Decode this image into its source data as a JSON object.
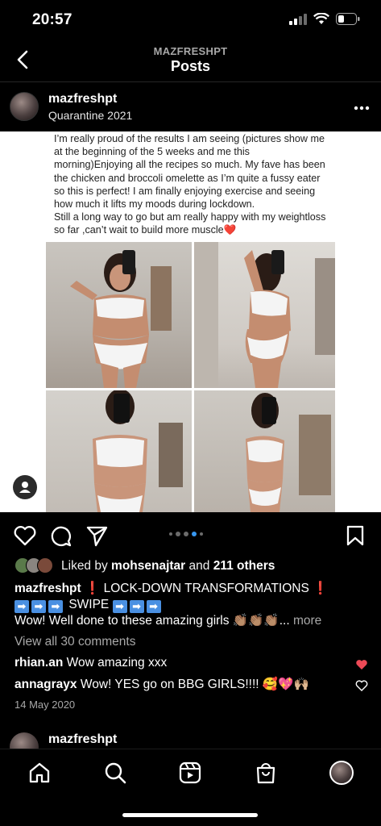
{
  "status_bar": {
    "time": "20:57"
  },
  "header": {
    "account": "MAZFRESHPT",
    "title": "Posts"
  },
  "post": {
    "username": "mazfreshpt",
    "location": "Quarantine 2021",
    "image_text": "I’m really proud of the results I am seeing (pictures show me\nat the beginning of the 5 weeks and me this\nmorning)Enjoying all the recipes so much. My fave has been\nthe chicken and broccoli omelette as I’m quite a fussy eater\nso this is perfect! I am finally enjoying exercise and seeing\nhow much it lifts my moods during lockdown.\nStill a long way to go but am really happy with my weightloss\nso far ,can’t wait to build more muscle❤️",
    "carousel": {
      "count": 5,
      "active_index": 3
    },
    "likes": {
      "prefix": "Liked by",
      "user": "mohsenajtar",
      "and": "and",
      "others": "211 others"
    },
    "caption": {
      "username": "mazfreshpt",
      "headline": "LOCK-DOWN TRANSFORMATIONS",
      "exclaim": "❗",
      "arrow": "➡",
      "swipe": "SWIPE",
      "line3": "Wow! Well done to these amazing girls 👏🏽👏🏽👏🏽...",
      "more": "more"
    },
    "view_comments": "View all 30 comments",
    "comments": [
      {
        "user": "rhian.an",
        "text": "Wow amazing xxx",
        "liked": true
      },
      {
        "user": "annagrayx",
        "text": "Wow! YES go on BBG GIRLS!!!! 🥰💖🙌🏼",
        "liked": false
      }
    ],
    "date": "14 May 2020"
  },
  "next_post": {
    "username": "mazfreshpt"
  },
  "colors": {
    "liked_heart": "#ed4956",
    "carousel_active": "#3897f0",
    "background": "#000000"
  }
}
